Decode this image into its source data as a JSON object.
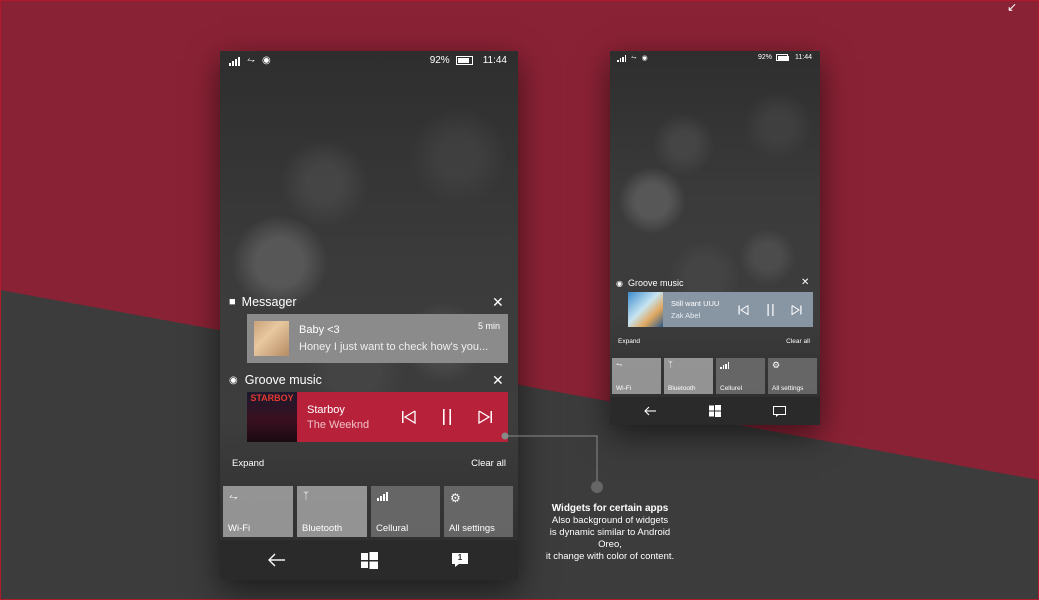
{
  "colors": {
    "accent": "#b8213a",
    "background_red": "#8a2235",
    "background_dark": "#3b3b3b"
  },
  "phone_large": {
    "status": {
      "battery": "92%",
      "time": "11:44"
    },
    "messager": {
      "app_name": "Messager",
      "title": "Baby <3",
      "time": "5 min",
      "body": "Honey I just want to check how's you..."
    },
    "groove": {
      "app_name": "Groove music",
      "cover_text": "STARBOY",
      "track": "Starboy",
      "artist": "The Weeknd"
    },
    "actions": {
      "expand": "Expand",
      "clear_all": "Clear all"
    },
    "quick_tiles": [
      {
        "label": "Wi-Fi",
        "icon": "wifi-icon",
        "state": "on"
      },
      {
        "label": "Bluetooth",
        "icon": "bluetooth-icon",
        "state": "on"
      },
      {
        "label": "Cellural",
        "icon": "cellular-icon",
        "state": "off"
      },
      {
        "label": "All settings",
        "icon": "gear-icon",
        "state": "off"
      }
    ],
    "nav": {
      "notification_count": "1"
    }
  },
  "phone_small": {
    "status": {
      "battery": "92%",
      "time": "11:44"
    },
    "groove": {
      "app_name": "Groove music",
      "track": "Still want UUU",
      "artist": "Zak Abel"
    },
    "actions": {
      "expand": "Expand",
      "clear_all": "Clear all"
    },
    "quick_tiles": [
      {
        "label": "Wi-Fi",
        "icon": "wifi-icon",
        "state": "on"
      },
      {
        "label": "Bluetooth",
        "icon": "bluetooth-icon",
        "state": "on"
      },
      {
        "label": "Cellurel",
        "icon": "cellular-icon",
        "state": "off"
      },
      {
        "label": "All settings",
        "icon": "gear-icon",
        "state": "off"
      }
    ]
  },
  "annotation": {
    "title": "Widgets for certain apps",
    "line1": "Also background of widgets",
    "line2": "is dynamic similar to Android Oreo,",
    "line3": "it change with color of content."
  }
}
